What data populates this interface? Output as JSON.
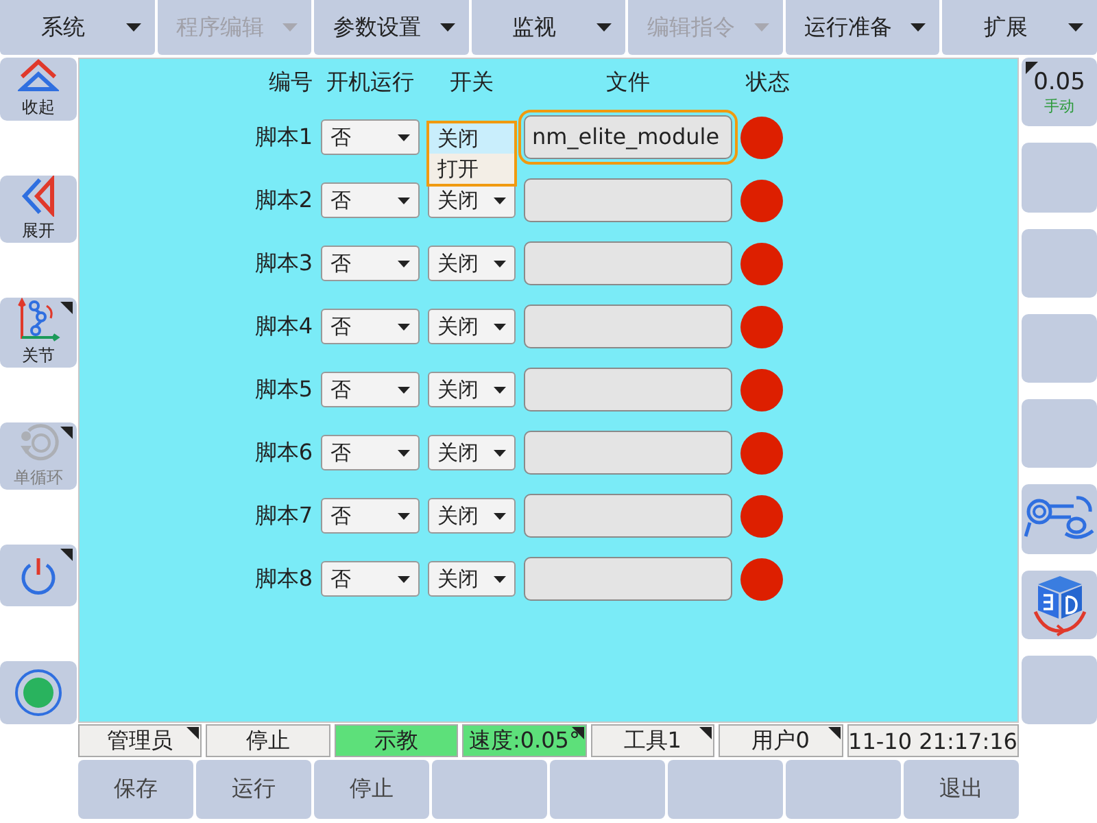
{
  "menu": [
    {
      "label": "系统",
      "disabled": false
    },
    {
      "label": "程序编辑",
      "disabled": true
    },
    {
      "label": "参数设置",
      "disabled": false
    },
    {
      "label": "监视",
      "disabled": false
    },
    {
      "label": "编辑指令",
      "disabled": true
    },
    {
      "label": "运行准备",
      "disabled": false
    },
    {
      "label": "扩展",
      "disabled": false
    }
  ],
  "left_tools": [
    {
      "kind": "collapse",
      "label": "收起",
      "disabled": false,
      "flag": false
    },
    {
      "kind": "expand",
      "label": "展开",
      "disabled": false,
      "flag": false
    },
    {
      "kind": "joint",
      "label": "关节",
      "disabled": false,
      "flag": true
    },
    {
      "kind": "cycle",
      "label": "单循环",
      "disabled": true,
      "flag": true
    },
    {
      "kind": "power",
      "disabled": false,
      "flag": true
    },
    {
      "kind": "record",
      "disabled": false,
      "flag": false
    }
  ],
  "right_tools": [
    {
      "kind": "speed",
      "value": "0.05",
      "mode": "手动",
      "flag": true
    },
    {
      "kind": "blank"
    },
    {
      "kind": "blank"
    },
    {
      "kind": "blank"
    },
    {
      "kind": "blank"
    },
    {
      "kind": "hand"
    },
    {
      "kind": "view3d"
    },
    {
      "kind": "blank"
    }
  ],
  "table": {
    "columns": [
      "编号",
      "开机运行",
      "开关",
      "文件",
      "状态"
    ],
    "rows": [
      {
        "name": "脚本1",
        "autostart": "否",
        "switch_menu": [
          {
            "label": "关闭",
            "selected": true
          },
          {
            "label": "打开",
            "selected": false
          }
        ],
        "file": "nm_elite_module",
        "focused": true,
        "running": false
      },
      {
        "name": "脚本2",
        "autostart": "否",
        "switch": "关闭",
        "focused": false,
        "running": false
      },
      {
        "name": "脚本3",
        "autostart": "否",
        "switch": "关闭",
        "focused": false,
        "running": false
      },
      {
        "name": "脚本4",
        "autostart": "否",
        "switch": "关闭",
        "focused": false,
        "running": false
      },
      {
        "name": "脚本5",
        "autostart": "否",
        "switch": "关闭",
        "focused": false,
        "running": false
      },
      {
        "name": "脚本6",
        "autostart": "否",
        "switch": "关闭",
        "focused": false,
        "running": false
      },
      {
        "name": "脚本7",
        "autostart": "否",
        "switch": "关闭",
        "focused": false,
        "running": false
      },
      {
        "name": "脚本8",
        "autostart": "否",
        "switch": "关闭",
        "focused": false,
        "running": false
      }
    ]
  },
  "status_bar": [
    {
      "text": "管理员",
      "highlight": false,
      "flag": true
    },
    {
      "text": "停止",
      "highlight": false,
      "flag": false
    },
    {
      "text": "示教",
      "highlight": true,
      "flag": false
    },
    {
      "text": "速度:0.05°",
      "highlight": true,
      "flag": true
    },
    {
      "text": "工具1",
      "highlight": false,
      "flag": true
    },
    {
      "text": "用户0",
      "highlight": false,
      "flag": true
    },
    {
      "text": "11-10 21:17:16",
      "highlight": false,
      "flag": false
    }
  ],
  "bottom_buttons": [
    {
      "kind": "text",
      "label": "保存"
    },
    {
      "kind": "text",
      "label": "运行"
    },
    {
      "kind": "text",
      "label": "停止"
    },
    {
      "kind": "blank"
    },
    {
      "kind": "blank"
    },
    {
      "kind": "blank"
    },
    {
      "kind": "blank"
    },
    {
      "kind": "text",
      "label": "退出"
    }
  ]
}
